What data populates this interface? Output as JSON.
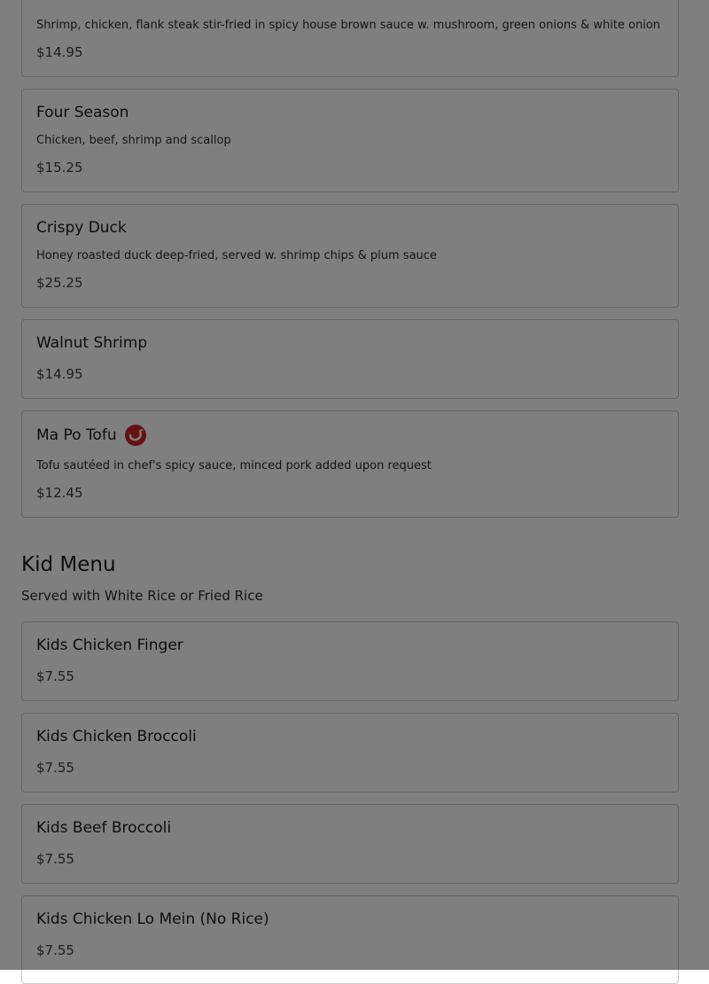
{
  "colors": {
    "spicy_icon": "#c8232c",
    "overlay": "rgba(0,0,0,0.5)"
  },
  "items": [
    {
      "name": "",
      "spicy": true,
      "description": "Shrimp, chicken, flank steak stir-fried in spicy house brown sauce w. mushroom, green onions & white onion",
      "price": "$14.95"
    },
    {
      "name": "Four Season",
      "spicy": false,
      "description": "Chicken, beef, shrimp and scallop",
      "price": "$15.25"
    },
    {
      "name": "Crispy Duck",
      "spicy": false,
      "description": "Honey roasted duck deep-fried, served w. shrimp chips & plum sauce",
      "price": "$25.25"
    },
    {
      "name": "Walnut Shrimp",
      "spicy": false,
      "description": "",
      "price": "$14.95"
    },
    {
      "name": "Ma Po Tofu",
      "spicy": true,
      "description": "Tofu sautéed in chef's spicy sauce, minced pork added upon request",
      "price": "$12.45"
    }
  ],
  "kid_menu": {
    "title": "Kid Menu",
    "subtitle": "Served with White Rice or Fried Rice",
    "items": [
      {
        "name": "Kids Chicken Finger",
        "price": "$7.55"
      },
      {
        "name": "Kids Chicken Broccoli",
        "price": "$7.55"
      },
      {
        "name": "Kids Beef Broccoli",
        "price": "$7.55"
      },
      {
        "name": "Kids Chicken Lo Mein (No Rice)",
        "price": "$7.55"
      }
    ]
  }
}
